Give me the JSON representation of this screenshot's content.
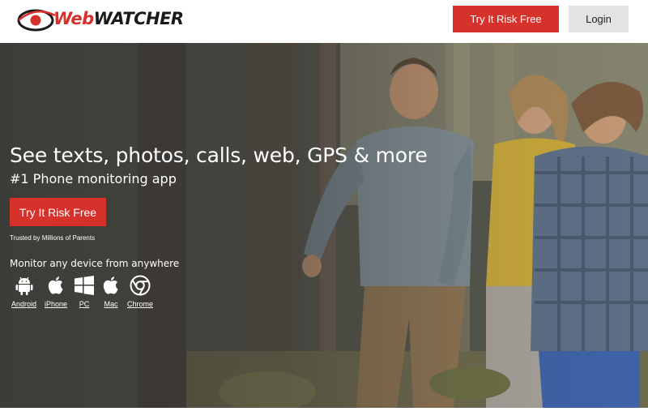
{
  "header": {
    "logo": {
      "part1": "Web",
      "part2": "WATCHER"
    },
    "try_button": "Try It Risk Free",
    "login_button": "Login"
  },
  "hero": {
    "title": "See texts, photos, calls, web, GPS & more",
    "subtitle": "#1 Phone monitoring app",
    "cta": "Try It Risk Free",
    "trusted": "Trusted by Millions of Parents",
    "monitor_heading": "Monitor any device from anywhere",
    "devices": [
      {
        "label": "Android",
        "icon": "android-icon"
      },
      {
        "label": "iPhone",
        "icon": "apple-icon"
      },
      {
        "label": "PC",
        "icon": "windows-icon"
      },
      {
        "label": "Mac",
        "icon": "apple-icon"
      },
      {
        "label": "Chrome",
        "icon": "chrome-icon"
      }
    ]
  },
  "colors": {
    "brand_red": "#d6322b",
    "login_gray": "#e3e3e3"
  }
}
